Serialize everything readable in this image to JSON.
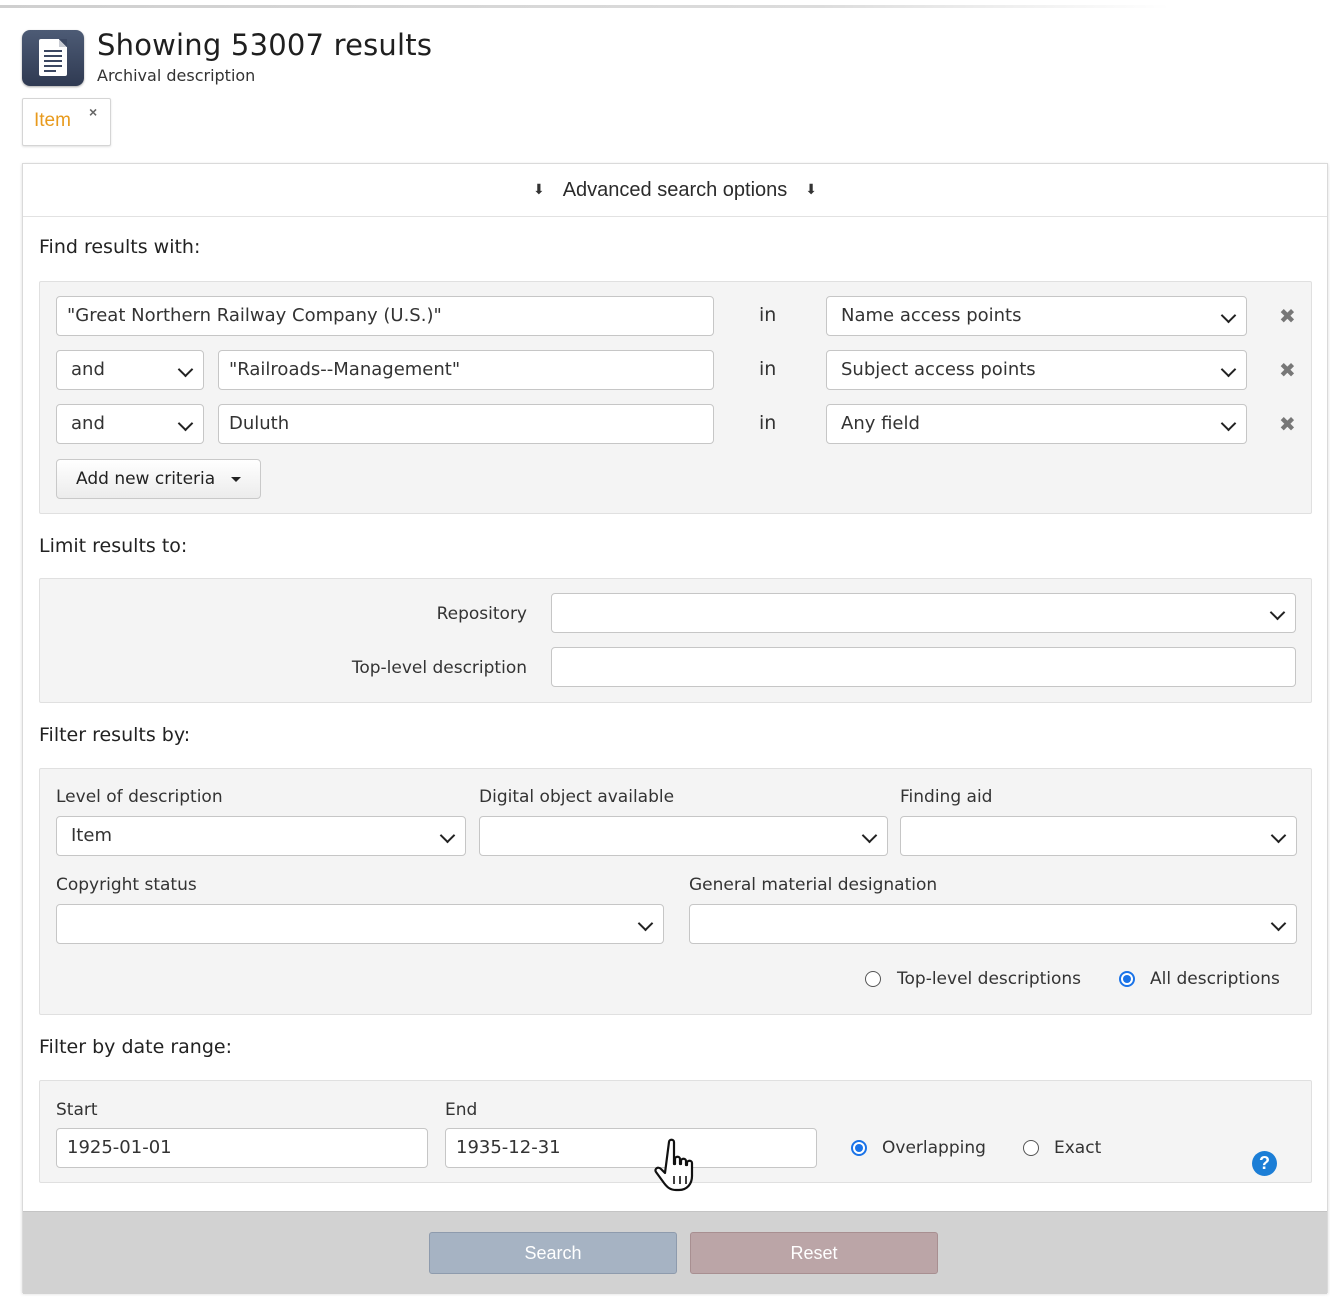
{
  "header": {
    "title": "Showing 53007 results",
    "subtitle": "Archival description",
    "icon": "document-icon"
  },
  "active_filter": {
    "label": "Item",
    "remove": "×"
  },
  "advanced": {
    "toggle_label": "Advanced search options",
    "find_heading": "Find results with:",
    "criteria": [
      {
        "operator": "",
        "query": "\"Great Northern Railway Company (U.S.)\"",
        "in": "in",
        "field": "Name access points"
      },
      {
        "operator": "and",
        "query": "\"Railroads--Management\"",
        "in": "in",
        "field": "Subject access points"
      },
      {
        "operator": "and",
        "query": "Duluth",
        "in": "in",
        "field": "Any field"
      }
    ],
    "add_criteria_label": "Add new criteria",
    "limit_heading": "Limit results to:",
    "repository_label": "Repository",
    "repository_value": "",
    "top_level_label": "Top-level description",
    "top_level_value": "",
    "filter_heading": "Filter results by:",
    "level_label": "Level of description",
    "level_value": "Item",
    "digital_label": "Digital object available",
    "digital_value": "",
    "finding_aid_label": "Finding aid",
    "finding_aid_value": "",
    "copyright_label": "Copyright status",
    "copyright_value": "",
    "gmd_label": "General material designation",
    "gmd_value": "",
    "scope_options": [
      {
        "label": "Top-level descriptions",
        "selected": false
      },
      {
        "label": "All descriptions",
        "selected": true
      }
    ],
    "date_heading": "Filter by date range:",
    "start_label": "Start",
    "start_value": "1925-01-01",
    "end_label": "End",
    "end_value": "1935-12-31",
    "date_type_options": [
      {
        "label": "Overlapping",
        "selected": true
      },
      {
        "label": "Exact",
        "selected": false
      }
    ],
    "help": "?"
  },
  "buttons": {
    "search": "Search",
    "reset": "Reset"
  },
  "colors": {
    "accent": "#1a73e8",
    "filter_tag_text": "#e89a1c",
    "search_button": "#a6b3c3",
    "reset_button": "#bba5a7"
  }
}
